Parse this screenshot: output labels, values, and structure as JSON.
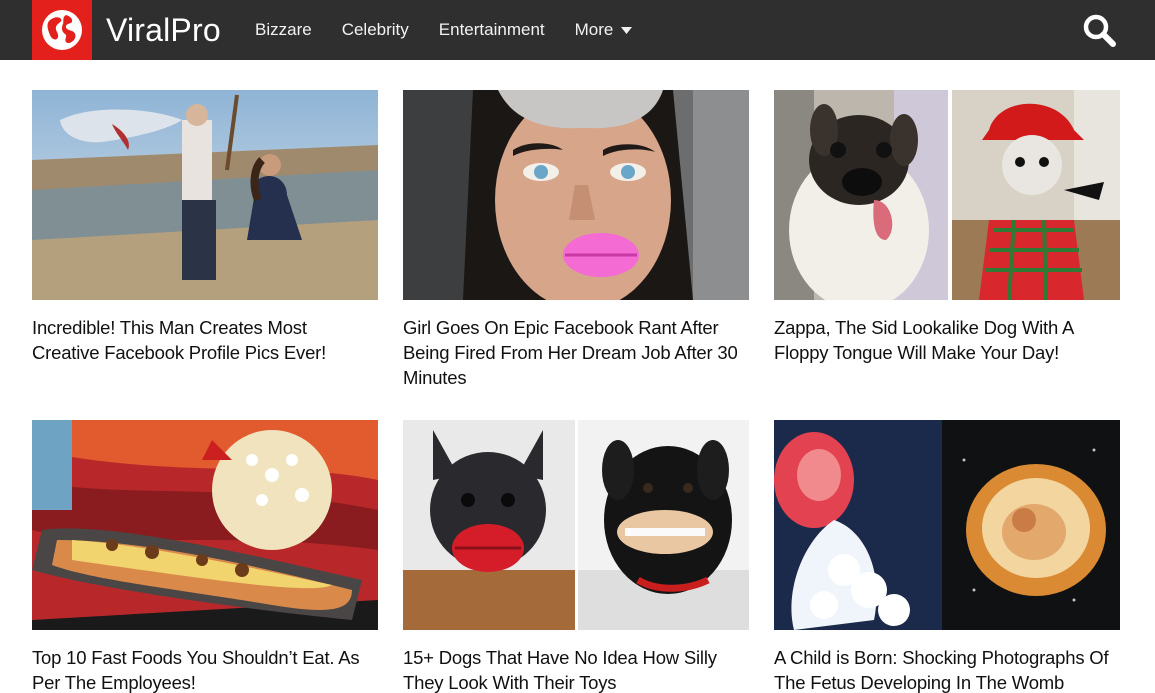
{
  "site": {
    "name": "ViralPro",
    "brand_color": "#e3201b",
    "header_bg": "#2f2f2f",
    "logo_icon": "globe-icon"
  },
  "nav": {
    "items": [
      {
        "label": "Bizzare"
      },
      {
        "label": "Celebrity"
      },
      {
        "label": "Entertainment"
      },
      {
        "label": "More",
        "icon": "caret-down-icon"
      }
    ],
    "search_icon": "search-icon"
  },
  "articles": [
    {
      "title": "Incredible! This Man Creates Most Creative Facebook Profile Pics Ever!"
    },
    {
      "title": "Girl Goes On Epic Facebook Rant After Being Fired From Her Dream Job After 30 Minutes"
    },
    {
      "title": "Zappa, The Sid Lookalike Dog With A Floppy Tongue Will Make Your Day!"
    },
    {
      "title": "Top 10 Fast Foods You Shouldn’t Eat. As Per The Employees!"
    },
    {
      "title": "15+ Dogs That Have No Idea How Silly They Look With Their Toys"
    },
    {
      "title": "A Child is Born: Shocking Photographs Of The Fetus Developing In The Womb"
    }
  ]
}
